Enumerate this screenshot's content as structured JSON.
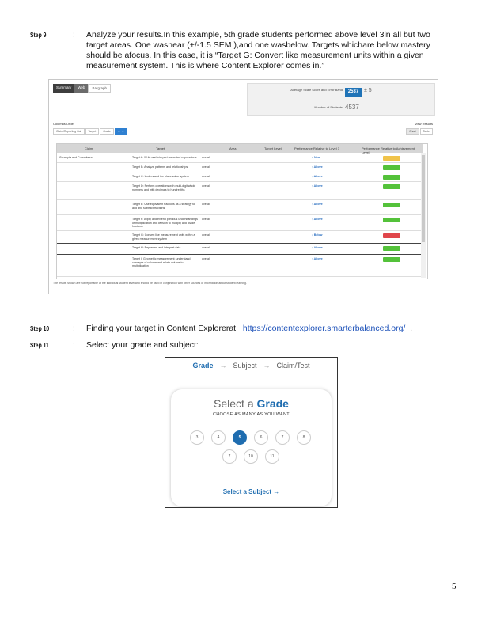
{
  "step9": {
    "label": "Step     9",
    "colon": ":",
    "line1": "Analyze your results.In this example, 5th grade students performed above level 3in all but two",
    "line2": "target areas. One wasnear (+/-1.5 SEM ),and one wasbelow. Targets whichare below mastery",
    "line3": "should be afocus. In this case, it is “Target G: Convert like measurement units within a given",
    "line4": "measurement system. This is where Content Explorer comes in.”"
  },
  "screenshot1": {
    "tabs": [
      "Summary",
      "Web",
      "Bargraph"
    ],
    "scale_score_label": "Average Scale Score and Error Band",
    "scale_score_value": "2537",
    "scale_score_sem": "± 5",
    "students_label": "Number of Students",
    "students_value": "4537",
    "toolbar_label": "Columns Order",
    "toolbar_controls": [
      "Claim/Reporting Cat",
      "Target",
      "Grade"
    ],
    "right_label": "View Results",
    "right_buttons": [
      "Chart",
      "Table"
    ],
    "columns": [
      "Claim",
      "Target",
      "Area",
      "Performance Relative to Level 3",
      "Target Level",
      "Performance Relative to Achievement Level"
    ],
    "rows": [
      {
        "claim": "Concepts and Procedures",
        "target": "Target A: Write and interpret numerical expressions",
        "area": "overall",
        "level3": "≈ Near",
        "pill_color": "#f0c34a",
        "pill_label": "Near"
      },
      {
        "claim": "",
        "target": "Target B: Analyze patterns and relationships",
        "area": "overall",
        "level3": "↑ Above",
        "pill_color": "#54c23a",
        "pill_label": "Above"
      },
      {
        "claim": "",
        "target": "Target C: Understand the place value system",
        "area": "overall",
        "level3": "↑ Above",
        "pill_color": "#54c23a",
        "pill_label": "Above"
      },
      {
        "claim": "",
        "target": "Target D: Perform operations with multi-digit whole numbers and with decimals to hundredths",
        "area": "overall",
        "level3": "↑ Above",
        "pill_color": "#54c23a",
        "pill_label": "Above"
      },
      {
        "claim": "",
        "target": "Target E: Use equivalent fractions as a strategy to add and subtract fractions",
        "area": "overall",
        "level3": "↑ Above",
        "pill_color": "#54c23a",
        "pill_label": "Above"
      },
      {
        "claim": "",
        "target": "Target F: Apply and extend previous understandings of multiplication and division to multiply and divide fractions",
        "area": "overall",
        "level3": "↑ Above",
        "pill_color": "#54c23a",
        "pill_label": "Above"
      },
      {
        "claim": "",
        "target": "Target G: Convert like measurement units within a given measurement system",
        "area": "overall",
        "level3": "↓ Below",
        "pill_color": "#e0464b",
        "pill_label": "Below"
      },
      {
        "claim": "",
        "target": "Target H: Represent and interpret data",
        "area": "overall",
        "level3": "↑ Above",
        "pill_color": "#54c23a",
        "pill_label": "Above"
      },
      {
        "claim": "",
        "target": "Target I: Geometric measurement: understand concepts of volume and relate volume to multiplication",
        "area": "overall",
        "level3": "↑ Above",
        "pill_color": "#54c23a",
        "pill_label": "Above"
      }
    ],
    "footnote": "The results shown are not reportable at the individual student level and should be used in conjunction with other sources of information about student learning."
  },
  "step10": {
    "label": "Step     10",
    "colon": ":",
    "text": "Finding your target in Content Explorerat",
    "link": "https://contentexplorer.smarterbalanced.org/",
    "after": "."
  },
  "step11": {
    "label": "Step     11",
    "colon": ":",
    "text": "Select your grade and subject:"
  },
  "screenshot2": {
    "crumbs": [
      "Grade",
      "Subject",
      "Claim/Test"
    ],
    "title_plain": "Select a ",
    "title_bold": "Grade",
    "subtitle": "CHOOSE AS MANY AS YOU WANT",
    "grades_row1": [
      "3",
      "4",
      "5",
      "6",
      "7",
      "8"
    ],
    "grades_row2": [
      "7",
      "10",
      "11"
    ],
    "selected_grade": "5",
    "next_label": "Select a Subject →"
  },
  "page_number": "5"
}
